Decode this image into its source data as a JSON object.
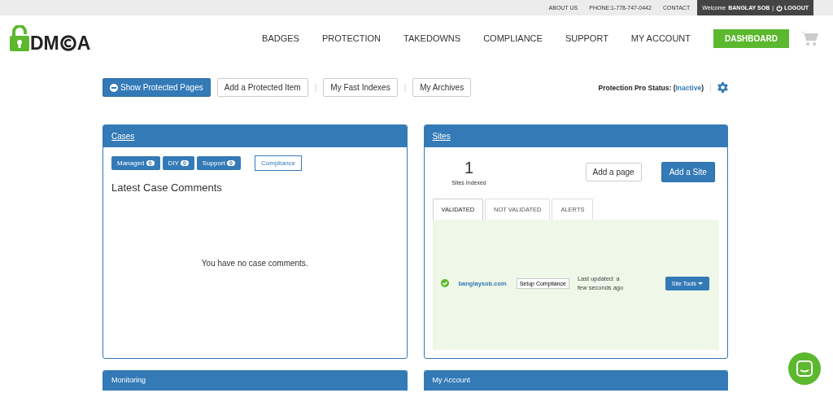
{
  "top_bar": {
    "links": [
      "ABOUT US",
      "PHONE:1-778-747-0442",
      "CONTACT"
    ],
    "welcome": "Welcome",
    "user": "BANGLAY SOB",
    "separator": "|",
    "logout": "LOGOUT"
  },
  "logo": {
    "text_before": "DM",
    "text_after": "A"
  },
  "nav": {
    "items": [
      "BADGES",
      "PROTECTION",
      "TAKEDOWNS",
      "COMPLIANCE",
      "SUPPORT",
      "MY ACCOUNT"
    ],
    "dashboard": "DASHBOARD"
  },
  "toolbar": {
    "primary": "Show Protected Pages",
    "buttons": [
      "Add a Protected Item",
      "My Fast Indexes",
      "My Archives"
    ],
    "separator": "|",
    "status_label": "Protection Pro Status:",
    "status_open": "(",
    "status_value": "Inactive",
    "status_close": ")"
  },
  "cases": {
    "title": "Cases",
    "counters": [
      {
        "label": "Managed",
        "count": "0"
      },
      {
        "label": "DIY",
        "count": "0"
      },
      {
        "label": "Support",
        "count": "0"
      }
    ],
    "compliance": "Compliance",
    "heading": "Latest Case Comments",
    "empty": "You have no case comments."
  },
  "sites": {
    "title": "Sites",
    "count": "1",
    "count_label": "Sites Indexed",
    "add_page": "Add a page",
    "add_site": "Add a Site",
    "tabs": [
      {
        "label": "VALIDATED",
        "selected": true
      },
      {
        "label": "NOT VALIDATED",
        "selected": false
      },
      {
        "label": "ALERTS",
        "selected": false
      }
    ],
    "rows": [
      {
        "validated": true,
        "domain": "banglaysob.com",
        "setup": "Setup Compliance",
        "updated": "Last updated: a few seconds ago",
        "tools": "Site Tools"
      }
    ]
  },
  "bottom_panels": [
    "Monitoring",
    "My Account"
  ]
}
